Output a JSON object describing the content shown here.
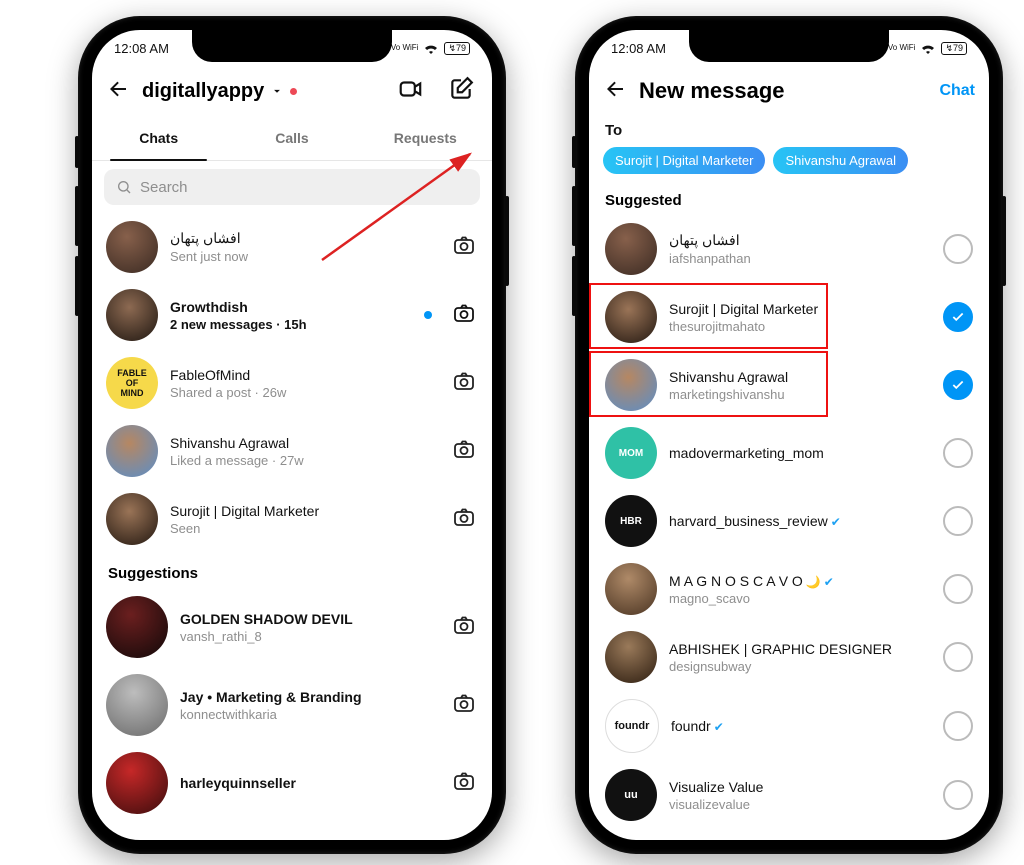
{
  "status": {
    "time": "12:08 AM",
    "tiny_dot": "•",
    "net": "Vo WiFi",
    "wifi": "",
    "battery": "79"
  },
  "left": {
    "account": "digitallyappy",
    "tabs": {
      "chats": "Chats",
      "calls": "Calls",
      "requests": "Requests"
    },
    "search_placeholder": "Search",
    "chat_items": [
      {
        "name": "افشاں پتھان",
        "sub": "Sent just now"
      },
      {
        "name": "Growthdish",
        "sub": "2 new messages · 15h",
        "bold": true,
        "unread": true
      },
      {
        "name": "FableOfMind",
        "sub": "Shared a post · 26w"
      },
      {
        "name": "Shivanshu Agrawal",
        "sub": "Liked a message · 27w",
        "story": true
      },
      {
        "name": "Surojit | Digital Marketer",
        "sub": "Seen"
      }
    ],
    "suggestions_header": "Suggestions",
    "suggestions": [
      {
        "name": "GOLDEN SHADOW DEVIL",
        "handle": "vansh_rathi_8"
      },
      {
        "name": "Jay • Marketing & Branding",
        "handle": "konnectwithkaria"
      },
      {
        "name": "harleyquinnseller",
        "handle": ""
      }
    ]
  },
  "right": {
    "title": "New message",
    "action": "Chat",
    "to_label": "To",
    "selected": [
      "Surojit | Digital Marketer",
      "Shivanshu Agrawal"
    ],
    "suggested_header": "Suggested",
    "items": [
      {
        "name": "افشاں پتھان",
        "handle": "iafshanpathan",
        "selected": false
      },
      {
        "name": "Surojit | Digital Marketer",
        "handle": "thesurojitmahato",
        "selected": true,
        "highlight": true
      },
      {
        "name": "Shivanshu Agrawal",
        "handle": "marketingshivanshu",
        "selected": true,
        "highlight": true
      },
      {
        "name": "madovermarketing_mom",
        "handle": "",
        "selected": false,
        "avatar_color": "#2fc1a6",
        "avatar_text": "MOM"
      },
      {
        "name": "harvard_business_review",
        "handle": "",
        "selected": false,
        "verified": true,
        "avatar_color": "#111",
        "avatar_text": "HBR"
      },
      {
        "name": "M A G N O   S C A V O",
        "handle": "magno_scavo",
        "selected": false,
        "emoji": "🌙",
        "verified": true
      },
      {
        "name": "ABHISHEK | GRAPHIC DESIGNER",
        "handle": "designsubway",
        "selected": false
      },
      {
        "name": "foundr",
        "handle": "",
        "selected": false,
        "verified": true,
        "avatar_color": "#fff",
        "avatar_text": "foundr",
        "text_dark": true
      },
      {
        "name": "Visualize Value",
        "handle": "visualizevalue",
        "selected": false,
        "avatar_color": "#111",
        "avatar_text": "uu"
      }
    ]
  }
}
